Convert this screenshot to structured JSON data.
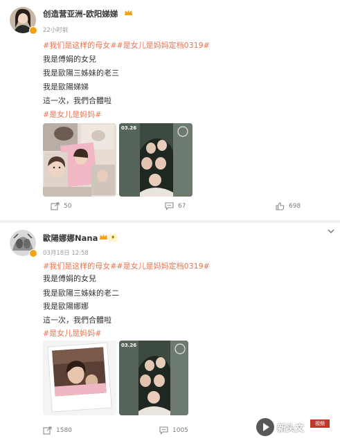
{
  "post1": {
    "user": {
      "name": "创造营亚洲-欧阳娣娣",
      "time": "22小时前"
    },
    "lines": [
      {
        "type": "tag",
        "text": "#我们是这样的母女##是女儿是妈妈定档0319#"
      },
      {
        "type": "text",
        "text": "我是傅娟的女兒"
      },
      {
        "type": "text",
        "text": "我是歐陽三姊妹的老三"
      },
      {
        "type": "text",
        "text": "我是歐陽娣娣"
      },
      {
        "type": "text",
        "text": "這一次，我們合體啦"
      },
      {
        "type": "tag",
        "text": "#是女儿是妈妈#"
      }
    ],
    "poster_date": "03.26",
    "actions": {
      "repost": "50",
      "comment": "67",
      "like": "698"
    }
  },
  "post2": {
    "user": {
      "name": "歐陽娜娜Nana",
      "time": "03月18日 12:58"
    },
    "lines": [
      {
        "type": "tag",
        "text": "#我们是这样的母女##是女儿是妈妈定档0319#"
      },
      {
        "type": "text",
        "text": "我是傅娟的女兒"
      },
      {
        "type": "text",
        "text": "我是歐陽三姊妹的老二"
      },
      {
        "type": "text",
        "text": "我是歐陽娜娜"
      },
      {
        "type": "text",
        "text": "這一次，我們合體啦"
      },
      {
        "type": "tag",
        "text": "#是女儿是妈妈#"
      }
    ],
    "poster_date": "03.26",
    "actions": {
      "repost": "1580",
      "comment": "1005"
    }
  },
  "watermark": {
    "text": "新头文",
    "stamp": "视频"
  },
  "colors": {
    "tag": "#eb7350",
    "text": "#333333",
    "meta": "#999999",
    "vip": "#f3a217"
  }
}
